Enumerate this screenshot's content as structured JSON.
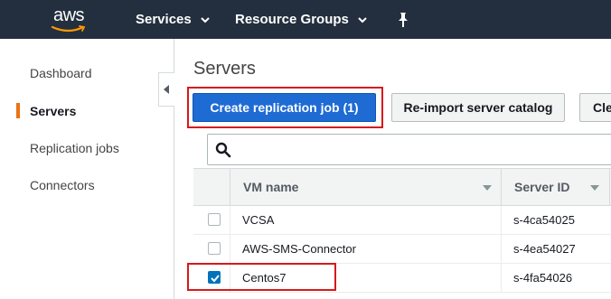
{
  "topnav": {
    "logo_text": "aws",
    "services_label": "Services",
    "resource_groups_label": "Resource Groups",
    "background": "#232f3e"
  },
  "sidebar": {
    "items": [
      {
        "label": "Dashboard",
        "active": false
      },
      {
        "label": "Servers",
        "active": true
      },
      {
        "label": "Replication jobs",
        "active": false
      },
      {
        "label": "Connectors",
        "active": false
      }
    ],
    "active_color": "#ec7211"
  },
  "main": {
    "title": "Servers",
    "buttons": {
      "create": "Create replication job (1)",
      "reimport": "Re-import server catalog",
      "clear": "Clear"
    },
    "search": {
      "placeholder": "",
      "value": ""
    },
    "table": {
      "columns": [
        "VM name",
        "Server ID"
      ],
      "rows": [
        {
          "checked": false,
          "vm_name": "VCSA",
          "server_id": "s-4ca54025"
        },
        {
          "checked": false,
          "vm_name": "AWS-SMS-Connector",
          "server_id": "s-4ea54027"
        },
        {
          "checked": true,
          "vm_name": "Centos7",
          "server_id": "s-4fa54026"
        }
      ]
    }
  },
  "colors": {
    "primary_button": "#1f6bd4",
    "highlight": "#d7191c",
    "checkbox_checked": "#0073bb"
  }
}
